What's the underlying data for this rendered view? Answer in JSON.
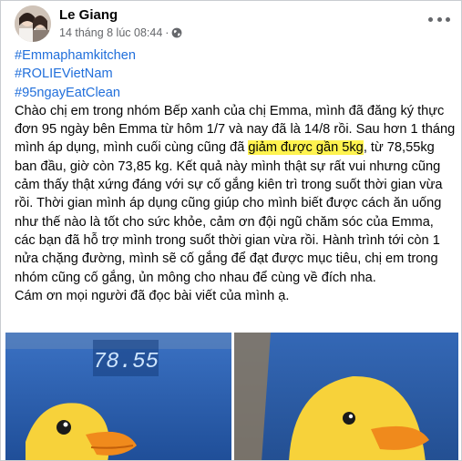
{
  "post": {
    "author": "Le Giang",
    "timestamp": "14 tháng 8 lúc 08:44",
    "separator": "·",
    "privacy_icon": "globe-icon",
    "more_icon": "more-options-icon",
    "hashtags": [
      "#Emmaphamkitchen",
      "#ROLIEVietNam",
      "#95ngayEatClean"
    ],
    "text_before_highlight": "Chào chị em trong nhóm Bếp xanh của chị Emma, mình đã đăng ký thực đơn 95 ngày bên Emma từ hôm 1/7 và nay đã là 14/8 rồi. Sau hơn 1 tháng mình áp dụng, mình cuối cùng cũng đã ",
    "highlight": "giảm được gần 5kg",
    "text_after_highlight": ", từ 78,55kg ban đầu, giờ còn 73,85 kg. Kết quả này mình thật sự rất vui nhưng cũng cảm thấy thật xứng đáng với sự cố gắng kiên trì trong suốt thời gian vừa rồi. Thời gian mình áp dụng cũng giúp cho mình biết được cách ăn uống như thế nào là tốt cho sức khỏe, cảm ơn đội ngũ chăm sóc của Emma, các bạn đã hỗ trợ mình trong suốt thời gian vừa rồi. Hành trình tới còn 1 nửa chặng đường, mình sẽ cố gắng để đạt được mục tiêu, chị em trong nhóm cũng cố gắng, ủn mông cho nhau để cùng về đích nha.",
    "closing": "Cám ơn mọi người đã đọc bài viết của mình ạ.",
    "scale_reading": "78.55"
  },
  "colors": {
    "link": "#216fdb",
    "highlight": "#fff34f",
    "meta_text": "#65676b",
    "scale_blue": "#2a5fb0"
  }
}
